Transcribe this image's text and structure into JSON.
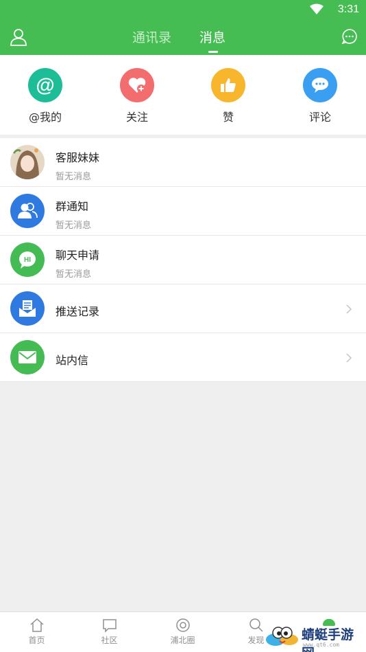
{
  "status_bar": {
    "time": "3:31"
  },
  "header": {
    "tabs": [
      {
        "label": "通讯录"
      },
      {
        "label": "消息"
      }
    ]
  },
  "quick_actions": [
    {
      "label": "@我的",
      "color": "#1dbd97"
    },
    {
      "label": "关注",
      "color": "#f36d6f"
    },
    {
      "label": "赞",
      "color": "#f8b62d"
    },
    {
      "label": "评论",
      "color": "#3a9ff0"
    }
  ],
  "conversations": [
    {
      "title": "客服妹妹",
      "subtitle": "暂无消息"
    },
    {
      "title": "群通知",
      "subtitle": "暂无消息",
      "color": "#2e7ae0"
    },
    {
      "title": "聊天申请",
      "subtitle": "暂无消息",
      "color": "#44bc53"
    }
  ],
  "links": [
    {
      "title": "推送记录",
      "color": "#2e7ae0"
    },
    {
      "title": "站内信",
      "color": "#44bc53"
    }
  ],
  "bottom_nav": [
    {
      "label": "首页"
    },
    {
      "label": "社区"
    },
    {
      "label": "浦北圈"
    },
    {
      "label": "发现"
    }
  ],
  "watermark": {
    "text": "蜻蜓手游网",
    "url": "www.qt6.com"
  },
  "colors": {
    "brand_green": "#45bd52"
  }
}
